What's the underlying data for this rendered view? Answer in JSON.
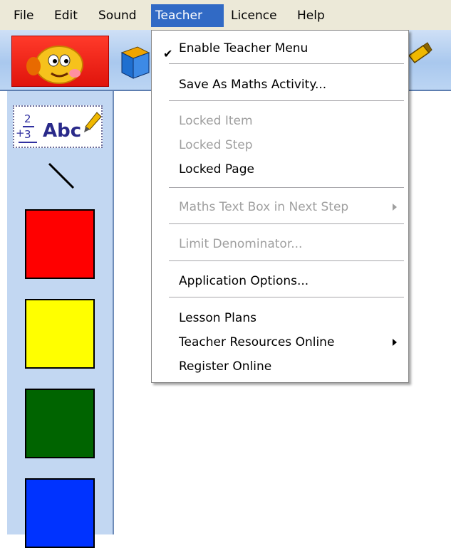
{
  "menubar": {
    "items": [
      "File",
      "Edit",
      "Sound",
      "Teacher",
      "Licence",
      "Help"
    ],
    "active": "Teacher"
  },
  "toolbar": {
    "icons": [
      "mascot-logo-icon",
      "box-icon",
      "pencil-icon"
    ]
  },
  "left_panel": {
    "math_tool_label": "Abc",
    "math_tool_fraction": {
      "numerator": "2",
      "prefix": "+",
      "denominator": "3"
    },
    "swatches": [
      {
        "name": "red",
        "color": "#ff0000"
      },
      {
        "name": "yellow",
        "color": "#ffff00"
      },
      {
        "name": "green",
        "color": "#006400"
      },
      {
        "name": "blue",
        "color": "#0033ff"
      }
    ]
  },
  "teacher_menu": {
    "items": [
      {
        "label": "Enable Teacher Menu",
        "checked": true,
        "enabled": true
      },
      {
        "label": "Save As Maths Activity...",
        "enabled": true
      },
      {
        "label": "Locked Item",
        "enabled": false
      },
      {
        "label": "Locked Step",
        "enabled": false
      },
      {
        "label": "Locked Page",
        "enabled": true
      },
      {
        "label": "Maths Text Box in Next Step",
        "enabled": false,
        "submenu": true
      },
      {
        "label": "Limit Denominator...",
        "enabled": false
      },
      {
        "label": "Application Options...",
        "enabled": true
      },
      {
        "label": "Lesson Plans",
        "enabled": true
      },
      {
        "label": "Teacher Resources Online",
        "enabled": true,
        "submenu": true
      },
      {
        "label": "Register Online",
        "enabled": true
      }
    ]
  },
  "colors": {
    "menu_highlight": "#316ac5",
    "menubar_bg": "#ece9d8",
    "panel_bg": "#c2d7f2"
  }
}
